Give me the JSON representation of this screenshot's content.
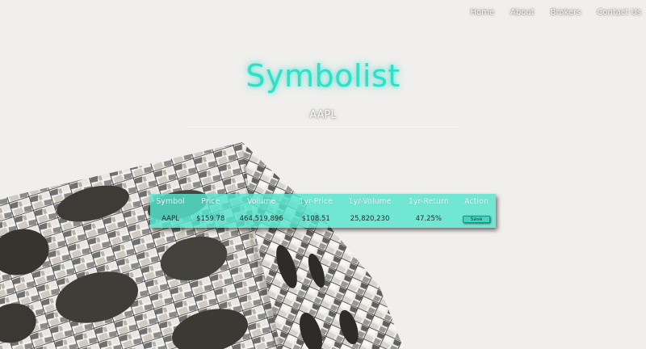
{
  "nav": {
    "items": [
      "Home",
      "About",
      "Brokers",
      "Contact Us"
    ]
  },
  "header": {
    "title": "Symbolist",
    "symbol": "AAPL"
  },
  "table": {
    "columns": [
      "Symbol",
      "Price",
      "Volume",
      "1yr-Price",
      "1yr-Volume",
      "1yr-Return",
      "Action"
    ],
    "rows": [
      {
        "symbol": "AAPL",
        "price": "$159.78",
        "volume": "464,519,896",
        "yr_price": "$108.51",
        "yr_volume": "25,820,230",
        "yr_return": "47.25%",
        "action": "Save"
      }
    ]
  },
  "colors": {
    "accent": "#2fe0c9",
    "panel": "#53e4cd",
    "background": "#f0efed"
  }
}
